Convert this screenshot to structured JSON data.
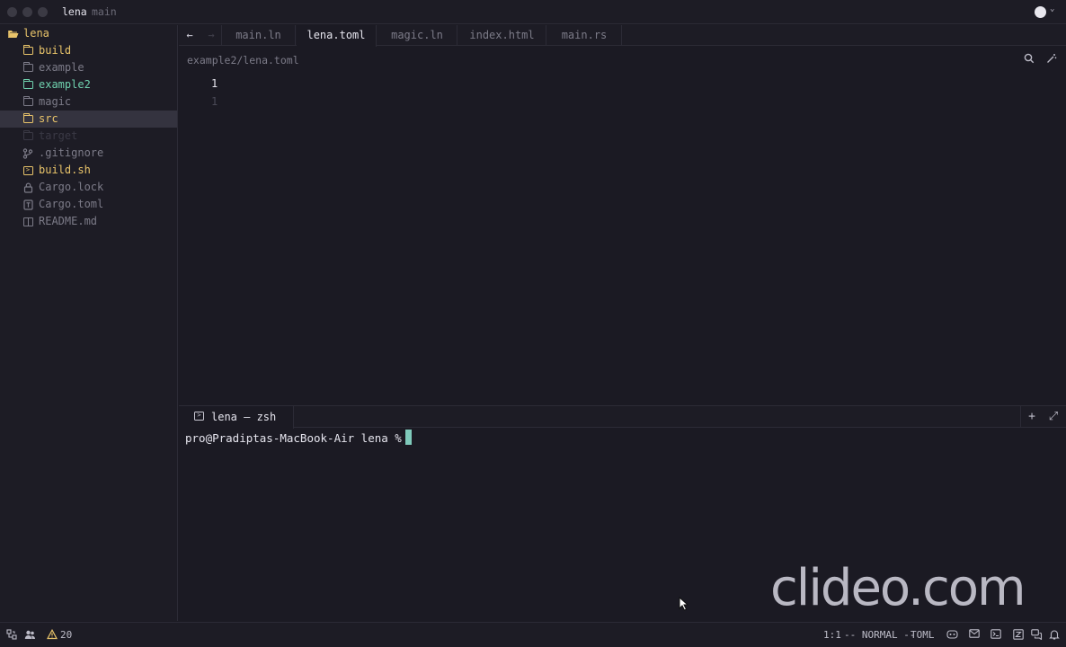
{
  "titlebar": {
    "project": "lena",
    "branch": "main"
  },
  "colors": {
    "folder_yellow": "#e9c46a",
    "git_green": "#6fd1ae",
    "muted": "#7c7b88",
    "cursor": "#7fcabb"
  },
  "sidebar": {
    "items": [
      {
        "label": "lena",
        "icon": "folder-open-icon",
        "color": "#e9c46a"
      },
      {
        "label": "build",
        "icon": "folder-icon",
        "color": "#e9c46a"
      },
      {
        "label": "example",
        "icon": "folder-icon",
        "color": "#7c7b88"
      },
      {
        "label": "example2",
        "icon": "folder-icon",
        "color": "#6fd1ae"
      },
      {
        "label": "magic",
        "icon": "folder-icon",
        "color": "#7c7b88"
      },
      {
        "label": "src",
        "icon": "folder-icon",
        "color": "#e9c46a"
      },
      {
        "label": "target",
        "icon": "folder-icon",
        "color": "#3a3945"
      },
      {
        "label": ".gitignore",
        "icon": "git-branch-icon",
        "color": "#7c7b88"
      },
      {
        "label": "build.sh",
        "icon": "terminal-file-icon",
        "color": "#e9c46a"
      },
      {
        "label": "Cargo.lock",
        "icon": "lock-icon",
        "color": "#7c7b88"
      },
      {
        "label": "Cargo.toml",
        "icon": "toml-file-icon",
        "color": "#7c7b88"
      },
      {
        "label": "README.md",
        "icon": "book-icon",
        "color": "#7c7b88"
      }
    ]
  },
  "tabs": {
    "back": "←",
    "forward": "→",
    "items": [
      {
        "label": "main.ln"
      },
      {
        "label": "lena.toml"
      },
      {
        "label": "magic.ln"
      },
      {
        "label": "index.html"
      },
      {
        "label": "main.rs"
      }
    ]
  },
  "editor": {
    "breadcrumb": "example2/lena.toml",
    "line_current": "1",
    "line_ghost": "1"
  },
  "terminal": {
    "tab_label": "lena — zsh",
    "prompt": "pro@Pradiptas-MacBook-Air lena %",
    "add": "+",
    "expand": "⤢"
  },
  "watermark": "clideo.com",
  "statusbar": {
    "warnings": "20",
    "position": "1:1",
    "mode": "-- NORMAL --",
    "language": "TOML"
  }
}
